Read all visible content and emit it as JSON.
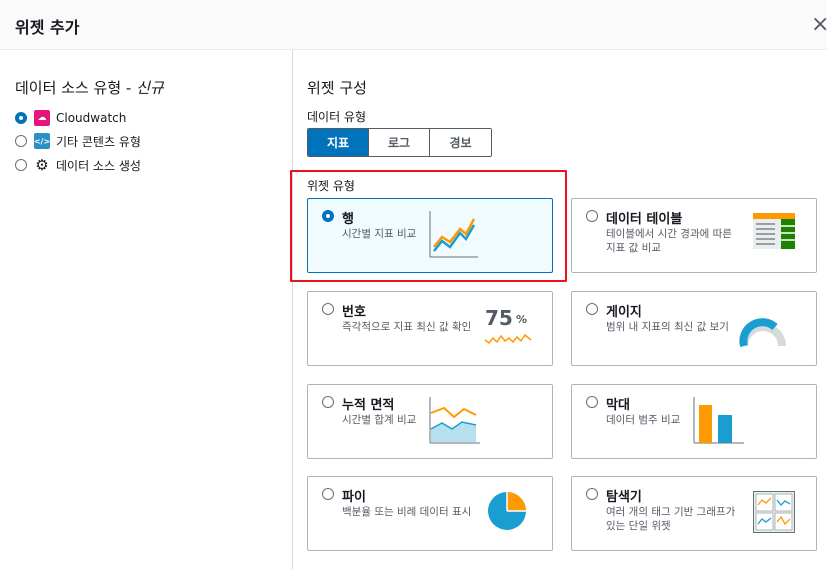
{
  "dialog": {
    "title": "위젯 추가",
    "close_icon": "×"
  },
  "data_source": {
    "heading": "데이터 소스 유형 - ",
    "heading_suffix": "신규",
    "options": [
      {
        "label": "Cloudwatch",
        "checked": true,
        "icon": "cloudwatch-icon"
      },
      {
        "label": "기타 콘텐츠 유형",
        "checked": false,
        "icon": "code-icon"
      },
      {
        "label": "데이터 소스 생성",
        "checked": false,
        "icon": "gear-icon"
      }
    ]
  },
  "widget_config": {
    "heading": "위젯 구성",
    "data_type_label": "데이터 유형",
    "data_types": [
      "지표",
      "로그",
      "경보"
    ],
    "selected_data_type": "지표",
    "widget_type_label": "위젯 유형",
    "number_value": "75",
    "number_unit": "%",
    "cards": [
      {
        "title": "행",
        "desc": "시간별 지표 비교",
        "selected": true
      },
      {
        "title": "데이터 테이블",
        "desc1": "테이블에서 시간 경과에 따른",
        "desc2": "지표 값 비교",
        "selected": false
      },
      {
        "title": "번호",
        "desc": "즉각적으로 지표 최신 값 확인",
        "selected": false
      },
      {
        "title": "게이지",
        "desc": "범위 내 지표의 최신 값 보기",
        "selected": false
      },
      {
        "title": "누적 면적",
        "desc": "시간별 합계 비교",
        "selected": false
      },
      {
        "title": "막대",
        "desc": "데이터 범주 비교",
        "selected": false
      },
      {
        "title": "파이",
        "desc": "백분율 또는 비례 데이터 표시",
        "selected": false
      },
      {
        "title": "탐색기",
        "desc1": "여러 개의 태그 기반 그래프가",
        "desc2": "있는 단일 위젯",
        "selected": false
      }
    ]
  },
  "colors": {
    "accent": "#0073bb",
    "highlight": "#e8141b",
    "orange": "#ff9900",
    "teal": "#1a9dd1"
  }
}
